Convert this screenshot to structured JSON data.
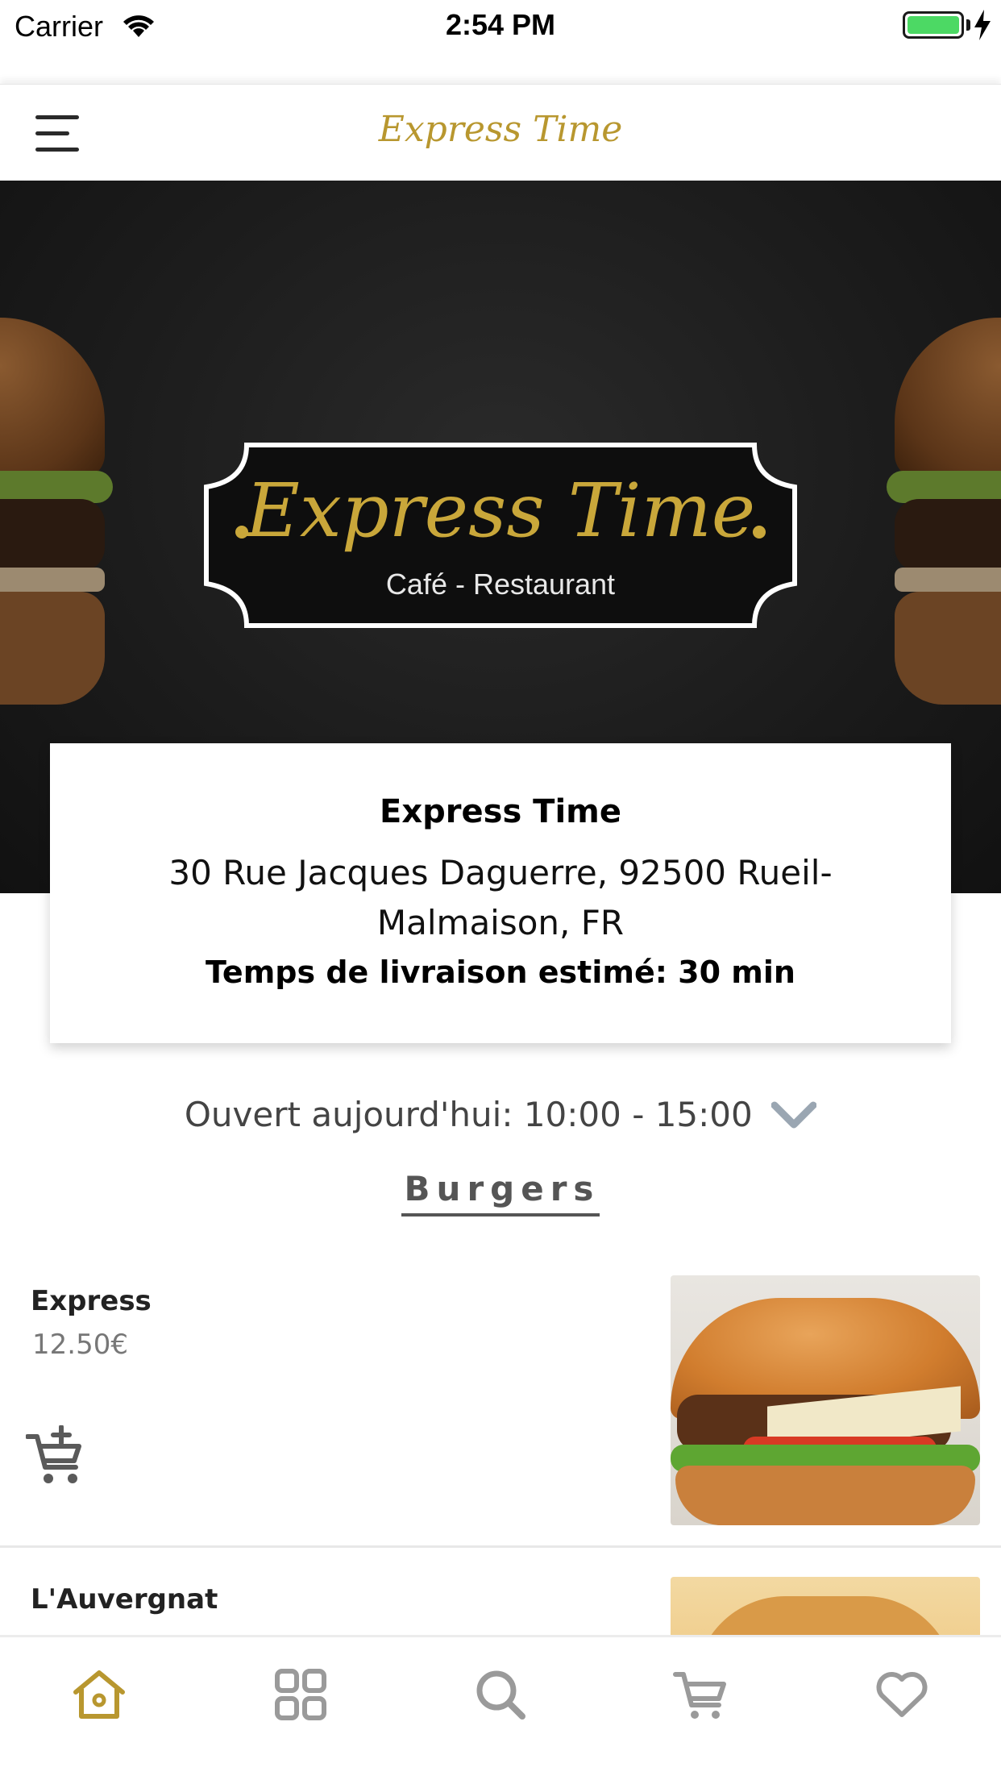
{
  "status_bar": {
    "carrier": "Carrier",
    "time": "2:54 PM"
  },
  "nav": {
    "title": "Express Time"
  },
  "hero": {
    "logo_name": "Express Time",
    "logo_subtitle": "Café - Restaurant"
  },
  "restaurant": {
    "name": "Express Time",
    "address": "30 Rue Jacques Daguerre, 92500 Rueil-Malmaison, FR",
    "delivery": "Temps de livraison estimé: 30 min",
    "hours": "Ouvert aujourd'hui: 10:00 - 15:00"
  },
  "category": {
    "title": "Burgers"
  },
  "products": [
    {
      "name": "Express",
      "price": "12.50€"
    },
    {
      "name": "L'Auvergnat"
    }
  ],
  "tabs": [
    "home-icon",
    "grid-icon",
    "search-icon",
    "cart-icon",
    "heart-icon"
  ],
  "colors": {
    "accent": "#b8972f",
    "inactive_icon": "#9a9a9a",
    "battery": "#4cd964"
  }
}
